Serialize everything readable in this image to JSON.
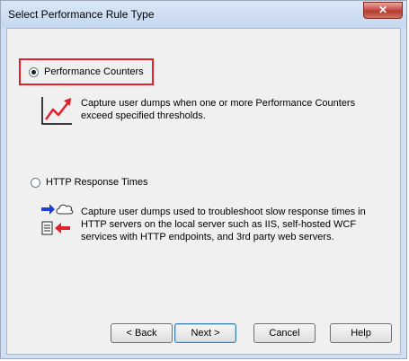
{
  "window": {
    "title": "Select Performance Rule Type",
    "close_glyph": "✕"
  },
  "options": [
    {
      "label": "Performance Counters",
      "selected": true,
      "description": "Capture user dumps when one or more Performance Counters exceed specified thresholds.",
      "icon": "line-chart-icon"
    },
    {
      "label": "HTTP Response Times",
      "selected": false,
      "description": "Capture user dumps used to troubleshoot slow response times in HTTP servers on the local server such as IIS, self-hosted WCF services with HTTP endpoints, and 3rd party web servers.",
      "icon": "http-request-response-icon"
    }
  ],
  "buttons": {
    "back": "< Back",
    "next": "Next >",
    "cancel": "Cancel",
    "help": "Help"
  },
  "colors": {
    "focus_border": "#e0202a",
    "arrow_red": "#e0202a",
    "arrow_blue": "#1c3fd6"
  }
}
